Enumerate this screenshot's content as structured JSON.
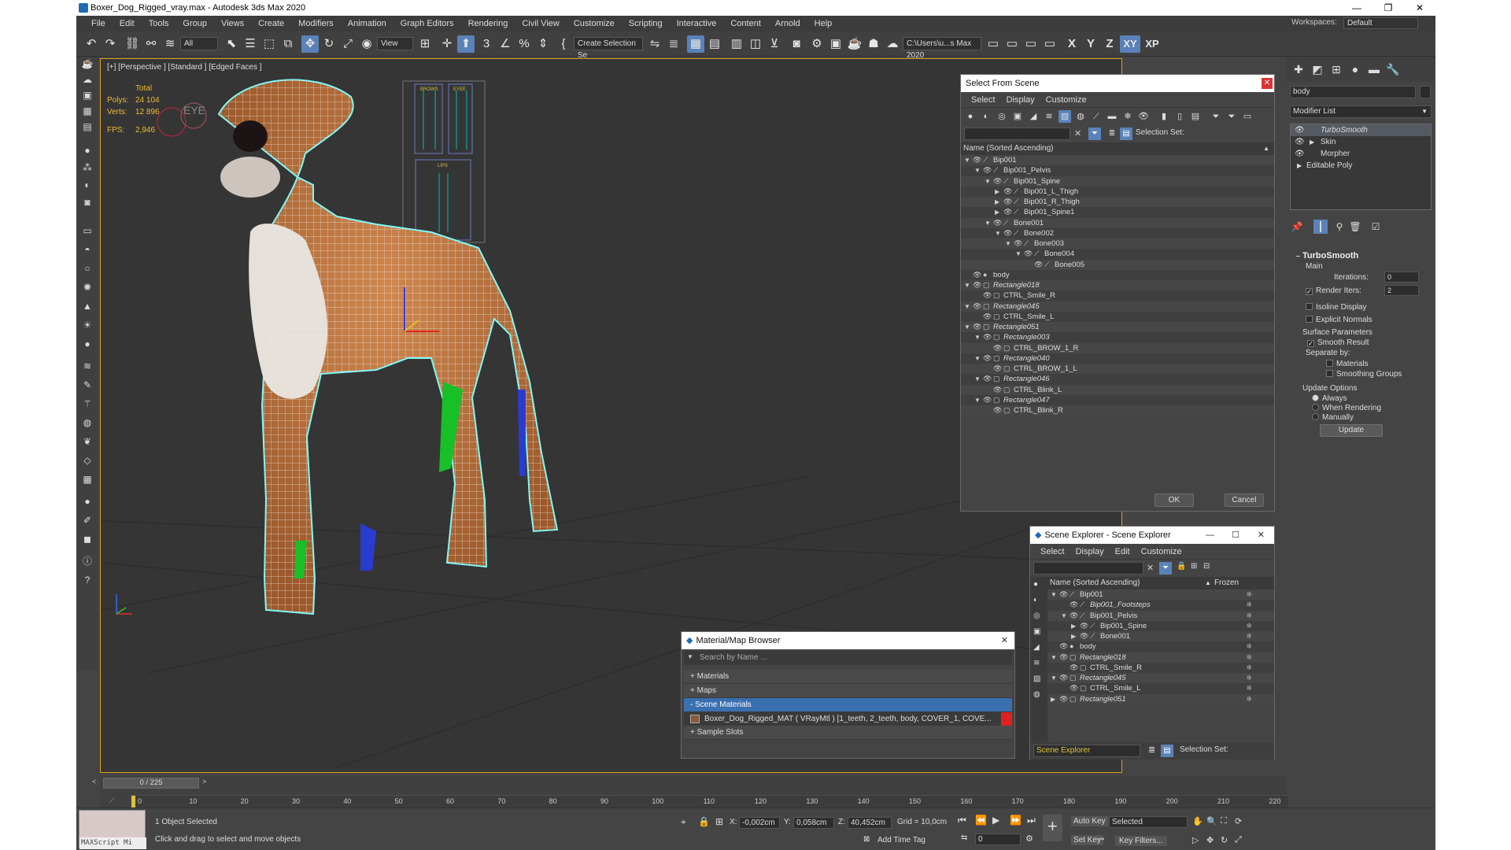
{
  "window": {
    "title": "Boxer_Dog_Rigged_vray.max - Autodesk 3ds Max 2020"
  },
  "menu": [
    "File",
    "Edit",
    "Tools",
    "Group",
    "Views",
    "Create",
    "Modifiers",
    "Animation",
    "Graph Editors",
    "Rendering",
    "Civil View",
    "Customize",
    "Scripting",
    "Interactive",
    "Content",
    "Arnold",
    "Help"
  ],
  "workspace": {
    "label": "Workspaces:",
    "value": "Default"
  },
  "toolbar": {
    "filter": "All",
    "refcoord": "View",
    "selset": "Create Selection Se",
    "path": "C:\\Users\\u...s Max 2020"
  },
  "axes": {
    "x": "X",
    "y": "Y",
    "z": "Z",
    "xy": "XY",
    "xp": "XP"
  },
  "viewport": {
    "label": "[+] [Perspective ] [Standard ] [Edged Faces ]",
    "stats": {
      "total_label": "Total",
      "polys_label": "Polys:",
      "polys": "24 104",
      "verts_label": "Verts:",
      "verts": "12 896",
      "fps_label": "FPS:",
      "fps": "2,946"
    },
    "eye_label": "EYE",
    "brows_label": "BROWS",
    "eyes_label": "EYEE",
    "lips_label": "LIPS",
    "colors": {
      "border": "#e0a020",
      "mesh_outline": "#7ff7f7",
      "body": "#c47a45"
    }
  },
  "select_from_scene": {
    "title": "Select From Scene",
    "menu": [
      "Select",
      "Display",
      "Customize"
    ],
    "selection_set_label": "Selection Set:",
    "column": "Name (Sorted Ascending)",
    "rows": [
      {
        "name": "Bip001",
        "indent": 0,
        "expand": "down",
        "type": "bone"
      },
      {
        "name": "Bip001_Pelvis",
        "indent": 1,
        "expand": "down",
        "type": "bone"
      },
      {
        "name": "Bip001_Spine",
        "indent": 2,
        "expand": "down",
        "type": "bone"
      },
      {
        "name": "Bip001_L_Thigh",
        "indent": 3,
        "expand": "right",
        "type": "bone"
      },
      {
        "name": "Bip001_R_Thigh",
        "indent": 3,
        "expand": "right",
        "type": "bone"
      },
      {
        "name": "Bip001_Spine1",
        "indent": 3,
        "expand": "right",
        "type": "bone"
      },
      {
        "name": "Bone001",
        "indent": 2,
        "expand": "down",
        "type": "bone"
      },
      {
        "name": "Bone002",
        "indent": 3,
        "expand": "down",
        "type": "bone"
      },
      {
        "name": "Bone003",
        "indent": 4,
        "expand": "down",
        "type": "bone"
      },
      {
        "name": "Bone004",
        "indent": 5,
        "expand": "down",
        "type": "bone"
      },
      {
        "name": "Bone005",
        "indent": 6,
        "expand": "none",
        "type": "bone"
      },
      {
        "name": "body",
        "indent": 0,
        "expand": "none",
        "type": "geo"
      },
      {
        "name": "Rectangle018",
        "indent": 0,
        "expand": "down",
        "type": "shape",
        "italic": true
      },
      {
        "name": "CTRL_Smile_R",
        "indent": 1,
        "expand": "none",
        "type": "shape"
      },
      {
        "name": "Rectangle045",
        "indent": 0,
        "expand": "down",
        "type": "shape",
        "italic": true
      },
      {
        "name": "CTRL_Smile_L",
        "indent": 1,
        "expand": "none",
        "type": "shape"
      },
      {
        "name": "Rectangle051",
        "indent": 0,
        "expand": "down",
        "type": "shape",
        "italic": true
      },
      {
        "name": "Rectangle003",
        "indent": 1,
        "expand": "down",
        "type": "shape",
        "italic": true
      },
      {
        "name": "CTRL_BROW_1_R",
        "indent": 2,
        "expand": "none",
        "type": "shape"
      },
      {
        "name": "Rectangle040",
        "indent": 1,
        "expand": "down",
        "type": "shape",
        "italic": true
      },
      {
        "name": "CTRL_BROW_1_L",
        "indent": 2,
        "expand": "none",
        "type": "shape"
      },
      {
        "name": "Rectangle046",
        "indent": 1,
        "expand": "down",
        "type": "shape",
        "italic": true
      },
      {
        "name": "CTRL_Blink_L",
        "indent": 2,
        "expand": "none",
        "type": "shape"
      },
      {
        "name": "Rectangle047",
        "indent": 1,
        "expand": "down",
        "type": "shape",
        "italic": true
      },
      {
        "name": "CTRL_Blink_R",
        "indent": 2,
        "expand": "none",
        "type": "shape"
      }
    ],
    "ok": "OK",
    "cancel": "Cancel"
  },
  "scene_explorer": {
    "title": "Scene Explorer - Scene Explorer",
    "menu": [
      "Select",
      "Display",
      "Edit",
      "Customize"
    ],
    "col_name": "Name (Sorted Ascending)",
    "col_frozen": "Frozen",
    "rows": [
      {
        "name": "Bip001",
        "indent": 0,
        "expand": "down",
        "type": "bone"
      },
      {
        "name": "Bip001_Footsteps",
        "indent": 1,
        "expand": "none",
        "type": "bone",
        "italic": true
      },
      {
        "name": "Bip001_Pelvis",
        "indent": 1,
        "expand": "down",
        "type": "bone"
      },
      {
        "name": "Bip001_Spine",
        "indent": 2,
        "expand": "right",
        "type": "bone"
      },
      {
        "name": "Bone001",
        "indent": 2,
        "expand": "right",
        "type": "bone"
      },
      {
        "name": "body",
        "indent": 0,
        "expand": "none",
        "type": "geo"
      },
      {
        "name": "Rectangle018",
        "indent": 0,
        "expand": "down",
        "type": "shape",
        "italic": true
      },
      {
        "name": "CTRL_Smile_R",
        "indent": 1,
        "expand": "none",
        "type": "shape"
      },
      {
        "name": "Rectangle045",
        "indent": 0,
        "expand": "down",
        "type": "shape",
        "italic": true
      },
      {
        "name": "CTRL_Smile_L",
        "indent": 1,
        "expand": "none",
        "type": "shape"
      },
      {
        "name": "Rectangle051",
        "indent": 0,
        "expand": "right",
        "type": "shape",
        "italic": true
      }
    ],
    "footer_name": "Scene Explorer",
    "selection_set_label": "Selection Set:"
  },
  "material_browser": {
    "title": "Material/Map Browser",
    "search_placeholder": "Search by Name ...",
    "sections": [
      "+ Materials",
      "+ Maps",
      "- Scene Materials",
      "+ Sample Slots"
    ],
    "material": "Boxer_Dog_Rigged_MAT ( VRayMtl ) [1_teeth, 2_teeth, body, COVER_1, COVE..."
  },
  "command_panel": {
    "object_name": "body",
    "modifier_list": "Modifier List",
    "stack": [
      "TurboSmooth",
      "Skin",
      "Morpher",
      "Editable Poly"
    ],
    "turbosmooth": {
      "title": "TurboSmooth",
      "main": "Main",
      "iterations_label": "Iterations:",
      "iterations": "0",
      "render_iters_label": "Render Iters:",
      "render_iters": "2",
      "isoline": "Isoline Display",
      "explicit": "Explicit Normals",
      "surface": "Surface Parameters",
      "smooth_result": "Smooth Result",
      "separate_by": "Separate by:",
      "materials": "Materials",
      "smoothing_groups": "Smoothing Groups",
      "update_options": "Update Options",
      "always": "Always",
      "when_rendering": "When Rendering",
      "manually": "Manually",
      "update": "Update"
    }
  },
  "timeline": {
    "frame": "0 / 225",
    "ticks": [
      "0",
      "10",
      "20",
      "30",
      "40",
      "50",
      "60",
      "70",
      "80",
      "90",
      "100",
      "110",
      "120",
      "130",
      "140",
      "150",
      "160",
      "170",
      "180",
      "190",
      "200",
      "210",
      "220"
    ]
  },
  "status": {
    "maxscript": "MAXScript Mi",
    "selected": "1 Object Selected",
    "prompt": "Click and drag to select and move objects",
    "x_label": "X:",
    "x": "-0,002cm",
    "y_label": "Y:",
    "y": "0,058cm",
    "z_label": "Z:",
    "z": "40,452cm",
    "grid": "Grid = 10,0cm",
    "add_time_tag": "Add Time Tag",
    "auto_key": "Auto Key",
    "set_key": "Set Key",
    "selected_dd": "Selected",
    "key_filters": "Key Filters...",
    "frame_field": "0"
  }
}
